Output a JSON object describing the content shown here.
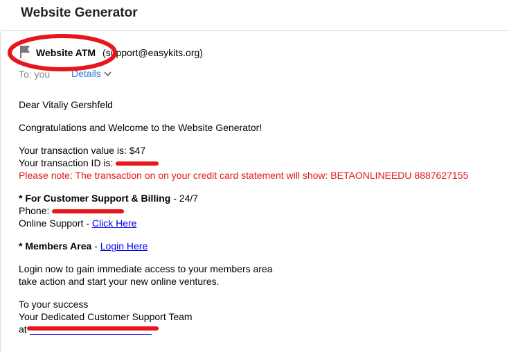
{
  "app": {
    "title": "Website Generator"
  },
  "message": {
    "sender_name": "Website ATM",
    "sender_email": "(support@easykits.org)",
    "to_label": "To: you",
    "details_label": "Details"
  },
  "body": {
    "greeting": "Dear Vitaliy Gershfeld",
    "welcome": "Congratulations and Welcome to the Website Generator!",
    "transaction_value": "Your transaction value is: $47",
    "transaction_id_label": "Your transaction ID is:",
    "note": "Please note: The transaction on on your credit card statement will show: BETAONLINEEDU 8887627155",
    "support_heading": "* For Customer Support & Billing",
    "support_hours": " - 24/7",
    "phone_label": "Phone:",
    "online_support_label": "Online Support - ",
    "click_here": "Click Here",
    "members_heading": "* Members Area",
    "members_sep": " - ",
    "login_here": "Login Here",
    "login_line1": "Login now to gain immediate access to your members area",
    "login_line2": "take action and start your new online ventures.",
    "closing1": "To your success",
    "closing2": "Your Dedicated Customer Support Team",
    "at_label": "at"
  },
  "colors": {
    "accent_red": "#e0161b",
    "link_blue": "#0000ee",
    "details_blue": "#3a7bd5"
  }
}
